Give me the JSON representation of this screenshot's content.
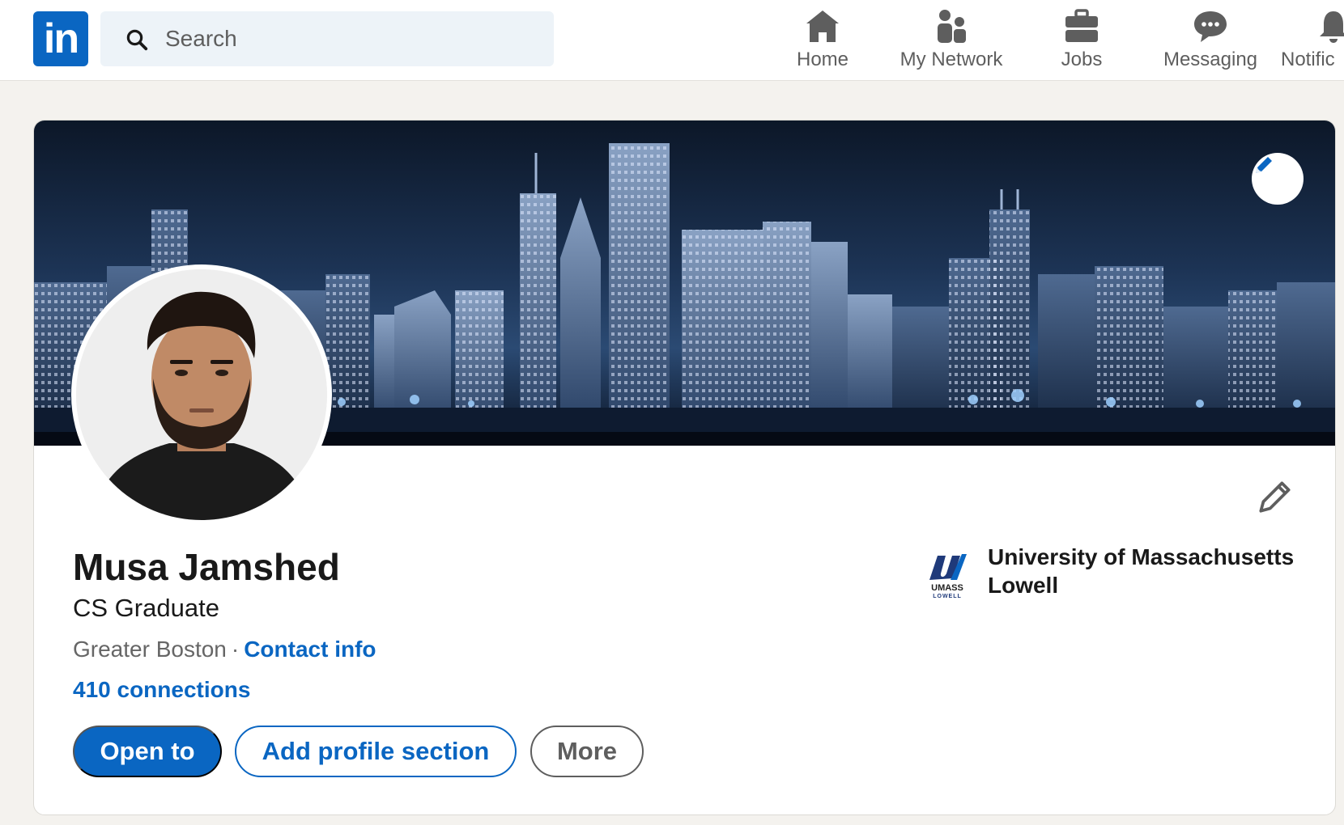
{
  "nav": {
    "logo_text": "in",
    "search_placeholder": "Search",
    "items": [
      {
        "label": "Home",
        "icon": "home-icon"
      },
      {
        "label": "My Network",
        "icon": "people-icon"
      },
      {
        "label": "Jobs",
        "icon": "briefcase-icon"
      },
      {
        "label": "Messaging",
        "icon": "chat-icon"
      },
      {
        "label": "Notific",
        "icon": "bell-icon"
      }
    ]
  },
  "profile": {
    "name": "Musa Jamshed",
    "headline": "CS Graduate",
    "location": "Greater Boston",
    "separator": "·",
    "contact_label": "Contact info",
    "connections": "410 connections",
    "buttons": {
      "open_to": "Open to",
      "add_section": "Add profile section",
      "more": "More"
    },
    "education": {
      "school": "University of Massachusetts Lowell",
      "logo_text_line1": "UMASS",
      "logo_text_line2": "LOWELL"
    }
  },
  "colors": {
    "brand": "#0a66c2",
    "page_bg": "#f4f2ee",
    "muted": "#666666"
  }
}
